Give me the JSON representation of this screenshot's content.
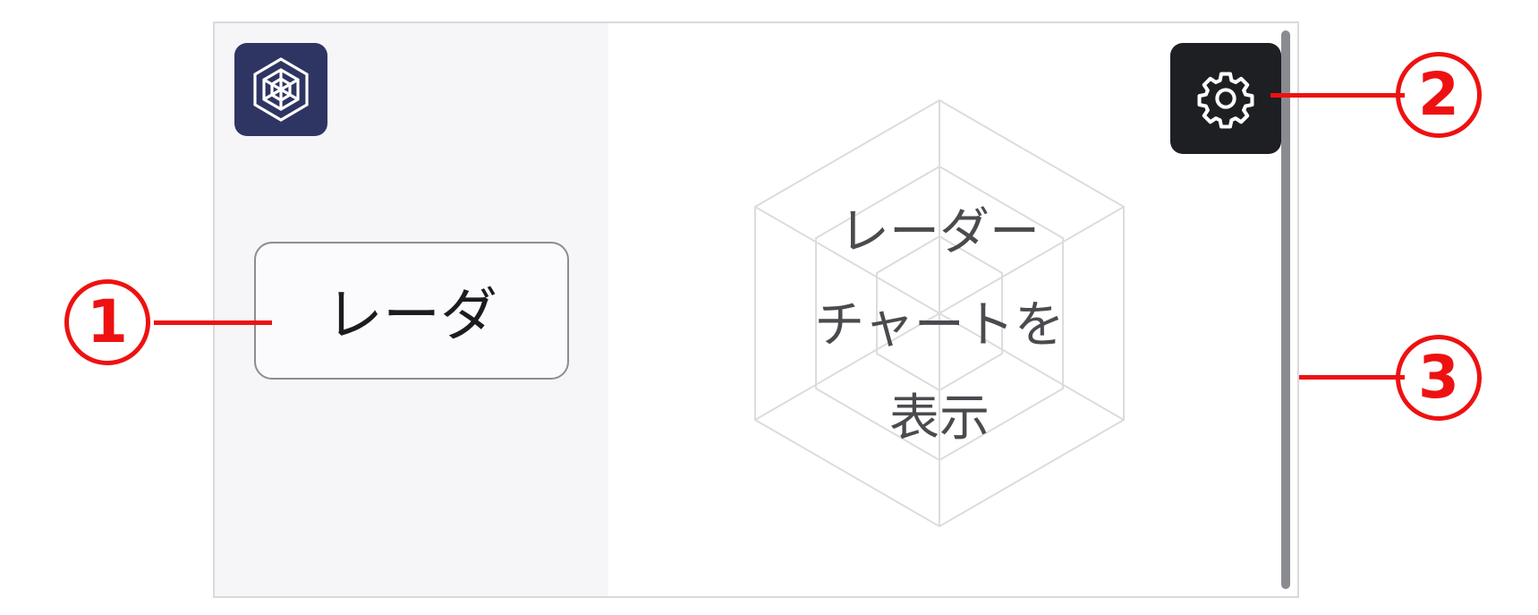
{
  "sidebar": {
    "logo_icon": "radar-hexagon-logo-icon",
    "logo_color": "#2f3563",
    "nav_button_label": "レーダ"
  },
  "main": {
    "placeholder_text": "レーダー\nチャートを\n表示",
    "placeholder_icon": "hexagon-radar-grid-icon",
    "settings_icon": "gear-icon"
  },
  "annotations": [
    {
      "label": "1",
      "target": "radar-nav-button"
    },
    {
      "label": "2",
      "target": "settings-button"
    },
    {
      "label": "3",
      "target": "scrollbar"
    }
  ],
  "colors": {
    "annotation": "#ee1111",
    "settings_bg": "#1e1f23",
    "sidebar_bg": "#f6f6f8"
  }
}
